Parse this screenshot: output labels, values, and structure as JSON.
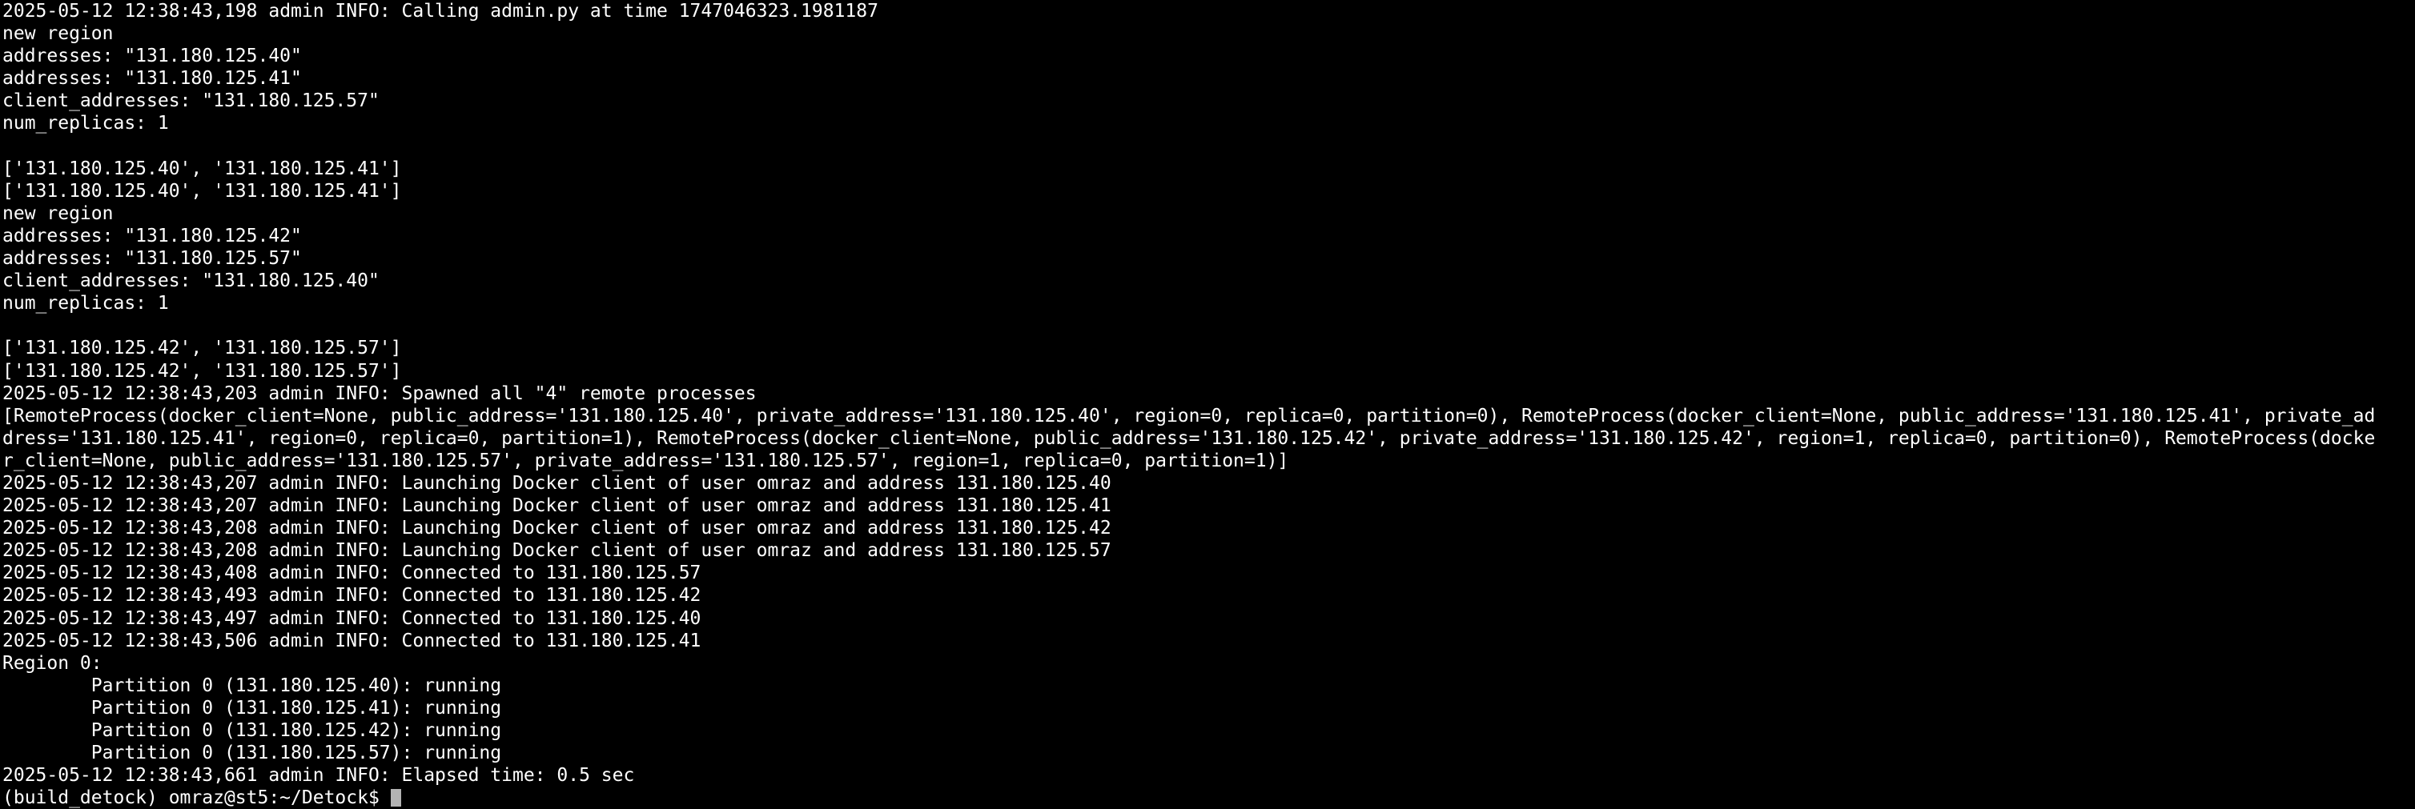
{
  "terminal": {
    "lines": [
      "2025-05-12 12:38:43,198\tadmin INFO: Calling admin.py at time 1747046323.1981187",
      "new region",
      "addresses: \"131.180.125.40\"",
      "addresses: \"131.180.125.41\"",
      "client_addresses: \"131.180.125.57\"",
      "num_replicas: 1",
      "",
      "['131.180.125.40', '131.180.125.41']",
      "['131.180.125.40', '131.180.125.41']",
      "new region",
      "addresses: \"131.180.125.42\"",
      "addresses: \"131.180.125.57\"",
      "client_addresses: \"131.180.125.40\"",
      "num_replicas: 1",
      "",
      "['131.180.125.42', '131.180.125.57']",
      "['131.180.125.42', '131.180.125.57']",
      "2025-05-12 12:38:43,203\tadmin INFO: Spawned all \"4\" remote processes",
      "[RemoteProcess(docker_client=None, public_address='131.180.125.40', private_address='131.180.125.40', region=0, replica=0, partition=0), RemoteProcess(docker_client=None, public_address='131.180.125.41', private_ad",
      "dress='131.180.125.41', region=0, replica=0, partition=1), RemoteProcess(docker_client=None, public_address='131.180.125.42', private_address='131.180.125.42', region=1, replica=0, partition=0), RemoteProcess(docke",
      "r_client=None, public_address='131.180.125.57', private_address='131.180.125.57', region=1, replica=0, partition=1)]",
      "2025-05-12 12:38:43,207\tadmin INFO: Launching Docker client of user omraz and address 131.180.125.40",
      "2025-05-12 12:38:43,207\tadmin INFO: Launching Docker client of user omraz and address 131.180.125.41",
      "2025-05-12 12:38:43,208\tadmin INFO: Launching Docker client of user omraz and address 131.180.125.42",
      "2025-05-12 12:38:43,208\tadmin INFO: Launching Docker client of user omraz and address 131.180.125.57",
      "2025-05-12 12:38:43,408\tadmin INFO: Connected to 131.180.125.57",
      "2025-05-12 12:38:43,493\tadmin INFO: Connected to 131.180.125.42",
      "2025-05-12 12:38:43,497\tadmin INFO: Connected to 131.180.125.40",
      "2025-05-12 12:38:43,506\tadmin INFO: Connected to 131.180.125.41",
      "Region 0:",
      "\tPartition 0 (131.180.125.40): running",
      "\tPartition 0 (131.180.125.41): running",
      "\tPartition 0 (131.180.125.42): running",
      "\tPartition 0 (131.180.125.57): running",
      "2025-05-12 12:38:43,661\tadmin INFO: Elapsed time: 0.5 sec"
    ],
    "prompt": "(build_detock) omraz@st5:~/Detock$ "
  },
  "colors": {
    "background": "#000000",
    "foreground": "#ffffff",
    "cursor": "#b3b3b3"
  }
}
